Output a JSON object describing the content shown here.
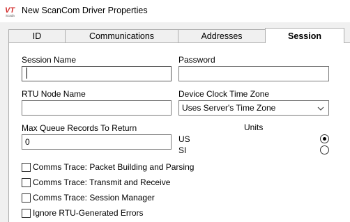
{
  "window": {
    "title": "New ScanCom Driver Properties",
    "logo_text": "VT",
    "logo_subtext": "Scada",
    "logo_color": "#d32f2f"
  },
  "tabs": [
    {
      "label": "ID",
      "selected": false
    },
    {
      "label": "Communications",
      "selected": false
    },
    {
      "label": "Addresses",
      "selected": false
    },
    {
      "label": "Session",
      "selected": true
    }
  ],
  "session": {
    "session_name": {
      "label": "Session Name",
      "value": ""
    },
    "password": {
      "label": "Password",
      "value": ""
    },
    "rtu_node_name": {
      "label": "RTU Node Name",
      "value": ""
    },
    "time_zone": {
      "label": "Device Clock Time Zone",
      "selected": "Uses Server's Time Zone"
    },
    "max_queue": {
      "label": "Max Queue Records To Return",
      "value": "0"
    },
    "units": {
      "label": "Units",
      "options": [
        {
          "label": "US",
          "checked": true
        },
        {
          "label": "SI",
          "checked": false
        }
      ]
    },
    "checkboxes": [
      {
        "label": "Comms Trace: Packet Building and Parsing",
        "checked": false
      },
      {
        "label": "Comms Trace: Transmit and Receive",
        "checked": false
      },
      {
        "label": "Comms Trace: Session Manager",
        "checked": false
      },
      {
        "label": "Ignore RTU-Generated Errors",
        "checked": false
      }
    ]
  }
}
